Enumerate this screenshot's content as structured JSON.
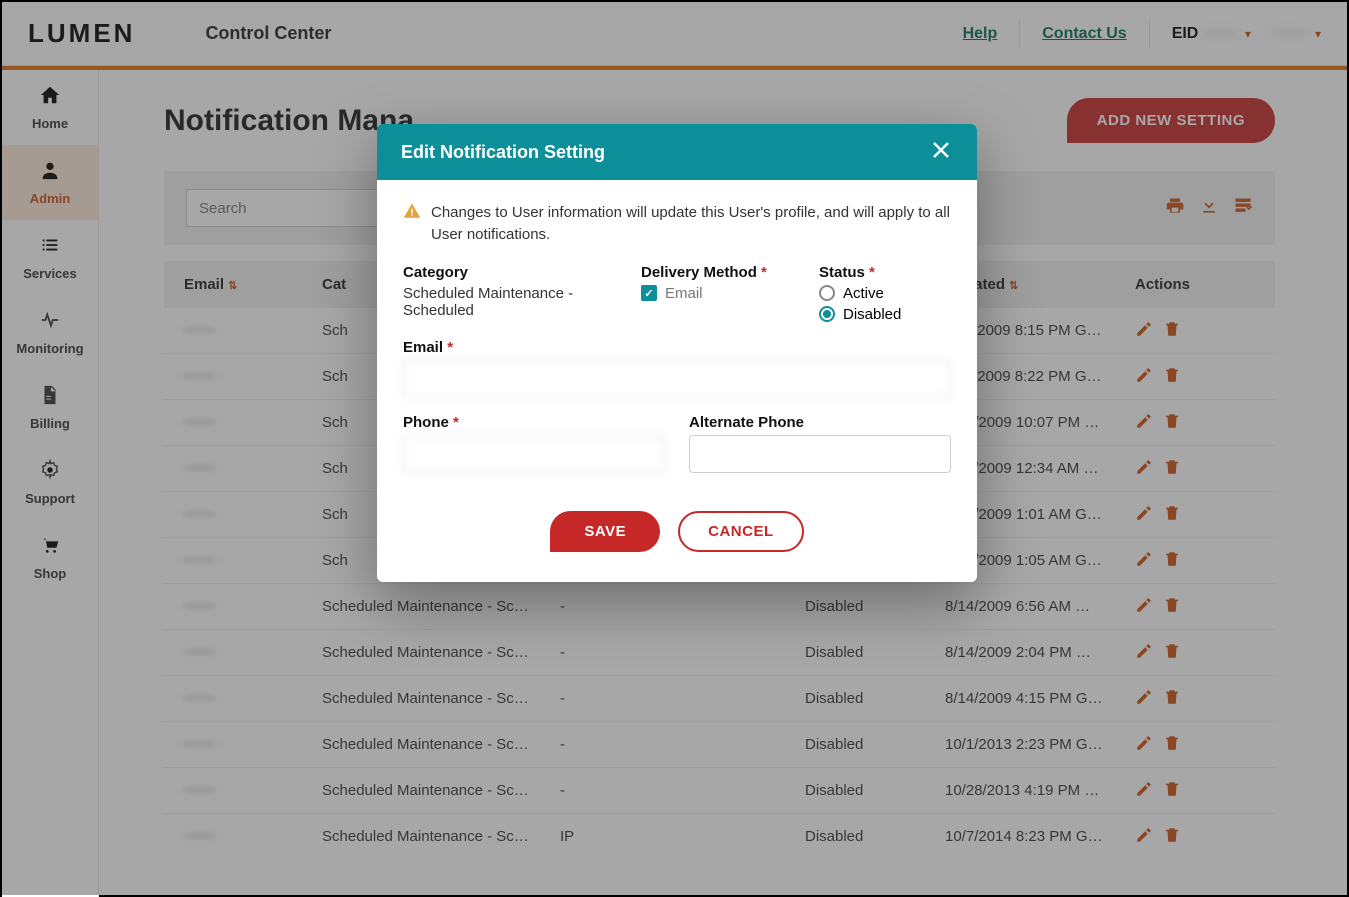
{
  "header": {
    "logo": "LUMEN",
    "app_title": "Control Center",
    "help": "Help",
    "contact": "Contact Us",
    "eid_label": "EID",
    "eid_value": "••••••",
    "user_value": "••••••"
  },
  "sidebar": {
    "items": [
      {
        "label": "Home",
        "icon": "home",
        "active": false
      },
      {
        "label": "Admin",
        "icon": "user",
        "active": true
      },
      {
        "label": "Services",
        "icon": "list",
        "active": false
      },
      {
        "label": "Monitoring",
        "icon": "pulse",
        "active": false
      },
      {
        "label": "Billing",
        "icon": "file",
        "active": false
      },
      {
        "label": "Support",
        "icon": "gear",
        "active": false
      },
      {
        "label": "Shop",
        "icon": "cart",
        "active": false
      }
    ]
  },
  "page": {
    "title": "Notification Mana",
    "add_button": "ADD NEW SETTING",
    "search_placeholder": "Search"
  },
  "table": {
    "columns": {
      "email": "Email",
      "category": "Cat",
      "delivery": "",
      "status": "",
      "updated": "Updated",
      "actions": "Actions"
    },
    "rows": [
      {
        "email": "••••••",
        "category": "Sch",
        "delivery": "",
        "status": "",
        "updated": "8/11/2009 8:15 PM G…"
      },
      {
        "email": "••••••",
        "category": "Sch",
        "delivery": "",
        "status": "",
        "updated": "8/11/2009 8:22 PM G…"
      },
      {
        "email": "••••••",
        "category": "Sch",
        "delivery": "",
        "status": "",
        "updated": "8/13/2009 10:07 PM …"
      },
      {
        "email": "••••••",
        "category": "Sch",
        "delivery": "",
        "status": "",
        "updated": "8/14/2009 12:34 AM …"
      },
      {
        "email": "••••••",
        "category": "Sch",
        "delivery": "",
        "status": "",
        "updated": "8/14/2009 1:01 AM G…"
      },
      {
        "email": "••••••",
        "category": "Sch",
        "delivery": "",
        "status": "",
        "updated": "8/14/2009 1:05 AM G…"
      },
      {
        "email": "••••••",
        "category": "Scheduled Maintenance - Sc…",
        "delivery": "-",
        "status": "Disabled",
        "updated": "8/14/2009 6:56 AM …"
      },
      {
        "email": "••••••",
        "category": "Scheduled Maintenance - Sc…",
        "delivery": "-",
        "status": "Disabled",
        "updated": "8/14/2009 2:04 PM …"
      },
      {
        "email": "••••••",
        "category": "Scheduled Maintenance - Sc…",
        "delivery": "-",
        "status": "Disabled",
        "updated": "8/14/2009 4:15 PM G…"
      },
      {
        "email": "••••••",
        "category": "Scheduled Maintenance - Sc…",
        "delivery": "-",
        "status": "Disabled",
        "updated": "10/1/2013 2:23 PM G…"
      },
      {
        "email": "••••••",
        "category": "Scheduled Maintenance - Sc…",
        "delivery": "-",
        "status": "Disabled",
        "updated": "10/28/2013 4:19 PM …"
      },
      {
        "email": "••••••",
        "category": "Scheduled Maintenance - Sc…",
        "delivery": "IP",
        "status": "Disabled",
        "updated": "10/7/2014 8:23 PM G…"
      }
    ]
  },
  "modal": {
    "title": "Edit Notification Setting",
    "warning": "Changes to User information will update this User's profile, and will apply to all User notifications.",
    "category_label": "Category",
    "category_value": "Scheduled Maintenance - Scheduled",
    "delivery_label": "Delivery Method",
    "delivery_option_email": "Email",
    "status_label": "Status",
    "status_active": "Active",
    "status_disabled": "Disabled",
    "email_label": "Email",
    "email_value": "",
    "phone_label": "Phone",
    "phone_value": "",
    "altphone_label": "Alternate Phone",
    "save": "SAVE",
    "cancel": "CANCEL"
  }
}
